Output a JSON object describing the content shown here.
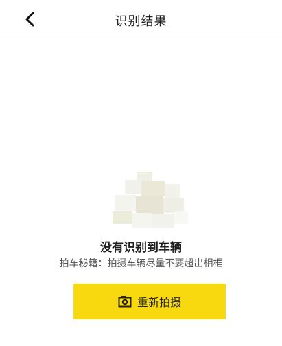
{
  "header": {
    "title": "识别结果",
    "back_icon": "chevron-left-icon"
  },
  "result": {
    "title": "没有识别到车辆",
    "tip": "拍车秘籍：拍摄车辆尽量不要超出相框"
  },
  "action": {
    "retake_label": "重新拍摄",
    "retake_icon": "camera-icon",
    "button_color": "#f8d90f"
  }
}
